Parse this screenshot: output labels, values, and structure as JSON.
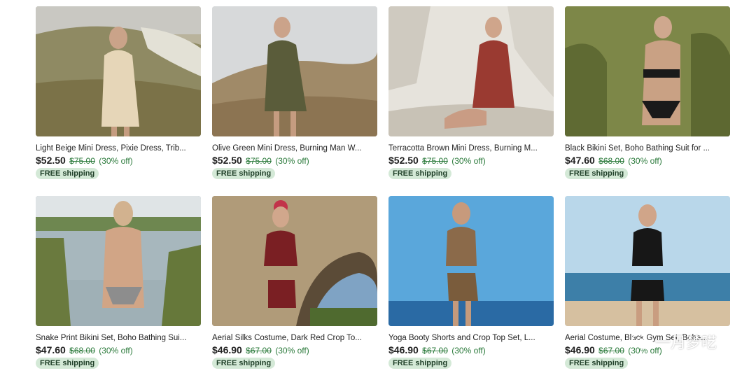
{
  "listings": [
    {
      "title": "Light Beige Mini Dress, Pixie Dress, Trib...",
      "price": "$52.50",
      "original_price": "$75.00",
      "discount": "(30% off)",
      "shipping": "FREE shipping",
      "image": "beige-dress-hillside"
    },
    {
      "title": "Olive Green Mini Dress, Burning Man W...",
      "price": "$52.50",
      "original_price": "$75.00",
      "discount": "(30% off)",
      "shipping": "FREE shipping",
      "image": "olive-dress-field"
    },
    {
      "title": "Terracotta Brown Mini Dress, Burning M...",
      "price": "$52.50",
      "original_price": "$75.00",
      "discount": "(30% off)",
      "shipping": "FREE shipping",
      "image": "terracotta-dress-chalk"
    },
    {
      "title": "Black Bikini Set, Boho Bathing Suit for ...",
      "price": "$47.60",
      "original_price": "$68.00",
      "discount": "(30% off)",
      "shipping": "FREE shipping",
      "image": "black-bikini-grass"
    },
    {
      "title": "Snake Print Bikini Set, Boho Bathing Sui...",
      "price": "$47.60",
      "original_price": "$68.00",
      "discount": "(30% off)",
      "shipping": "FREE shipping",
      "image": "snake-bikini-lake"
    },
    {
      "title": "Aerial Silks Costume, Dark Red Crop To...",
      "price": "$46.90",
      "original_price": "$67.00",
      "discount": "(30% off)",
      "shipping": "FREE shipping",
      "image": "red-set-stone-arch"
    },
    {
      "title": "Yoga Booty Shorts and Crop Top Set, L...",
      "price": "$46.90",
      "original_price": "$67.00",
      "discount": "(30% off)",
      "shipping": "FREE shipping",
      "image": "leopard-set-sea"
    },
    {
      "title": "Aerial Costume, Black Gym Set, Bohe...",
      "price": "$46.90",
      "original_price": "$67.00",
      "discount": "(30% off)",
      "shipping": "FREE shipping",
      "image": "black-set-beach"
    }
  ],
  "watermark": {
    "text": "一月梦呓",
    "icon": "wechat-icon"
  },
  "colors": {
    "discount_green": "#2b7a3b",
    "badge_bg": "#d4e9d7",
    "badge_text": "#1f3f28"
  }
}
